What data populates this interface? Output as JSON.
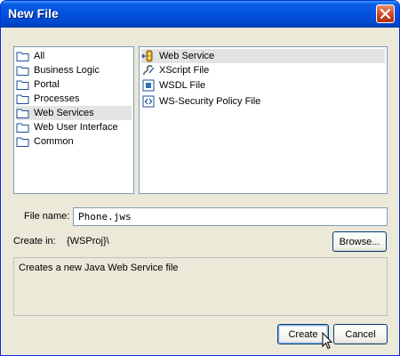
{
  "window": {
    "title": "New File"
  },
  "categories": [
    {
      "label": "All",
      "selected": false
    },
    {
      "label": "Business Logic",
      "selected": false
    },
    {
      "label": "Portal",
      "selected": false
    },
    {
      "label": "Processes",
      "selected": false
    },
    {
      "label": "Web Services",
      "selected": true
    },
    {
      "label": "Web User Interface",
      "selected": false
    },
    {
      "label": "Common",
      "selected": false
    }
  ],
  "file_types": [
    {
      "label": "Web Service",
      "icon": "web-service-icon",
      "selected": true
    },
    {
      "label": "XScript File",
      "icon": "xscript-icon",
      "selected": false
    },
    {
      "label": "WSDL File",
      "icon": "wsdl-icon",
      "selected": false
    },
    {
      "label": "WS-Security Policy File",
      "icon": "xml-file-icon",
      "selected": false
    }
  ],
  "form": {
    "file_name_label": "File name:",
    "file_name_value": "Phone.jws",
    "create_in_label": "Create in:",
    "create_in_value": "{WSProj}\\",
    "browse_label": "Browse..."
  },
  "description": "Creates a new Java Web Service file",
  "buttons": {
    "create": "Create",
    "cancel": "Cancel"
  },
  "colors": {
    "titlebar": "#0050de",
    "selection": "#e3e3e3",
    "dialog_bg": "#ece9d8"
  }
}
